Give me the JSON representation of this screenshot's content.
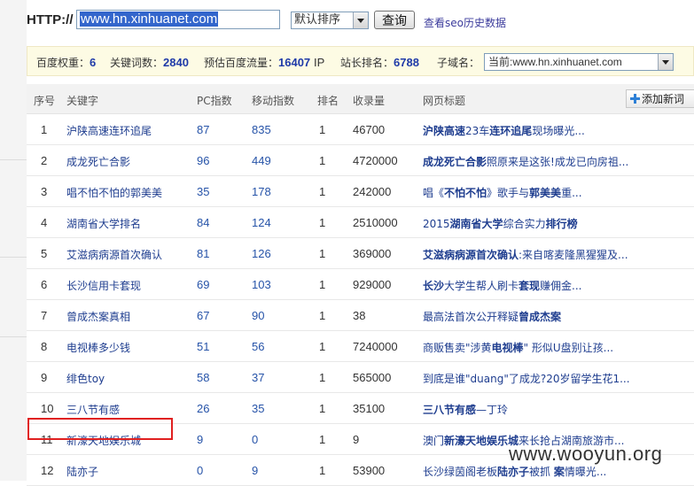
{
  "search": {
    "protocol_label": "HTTP://",
    "url_value": "www.hn.xinhuanet.com",
    "sort_selected": "默认排序",
    "query_button": "查询",
    "history_link": "查看seo历史数据"
  },
  "stats": {
    "baidu_weight_label": "百度权重：",
    "baidu_weight": "6",
    "keywords_label": "关键词数：",
    "keywords": "2840",
    "traffic_label": "预估百度流量：",
    "traffic": "16407",
    "traffic_unit": "IP",
    "rank_label": "站长排名：",
    "rank": "6788",
    "subdomain_label": "子域名：",
    "subdomain_selected": "当前:www.hn.xinhuanet.com"
  },
  "table": {
    "headers": {
      "index": "序号",
      "keyword": "关键字",
      "pc": "PC指数",
      "mobile": "移动指数",
      "rank": "排名",
      "indexed": "收录量",
      "title": "网页标题"
    },
    "add_button": "添加新词",
    "rows": [
      {
        "index": "1",
        "keyword": "沪陕高速连环追尾",
        "pc": "87",
        "mobile": "835",
        "rank": "1",
        "indexed": "46700",
        "title_html": "<b>沪陕高速</b>23车<b>连环追尾</b>现场曝光..."
      },
      {
        "index": "2",
        "keyword": "成龙死亡合影",
        "pc": "96",
        "mobile": "449",
        "rank": "1",
        "indexed": "4720000",
        "title_html": "<b>成龙死亡合影</b>照原来是这张!成龙已向房祖..."
      },
      {
        "index": "3",
        "keyword": "唱不怕不怕的郭美美",
        "pc": "35",
        "mobile": "178",
        "rank": "1",
        "indexed": "242000",
        "title_html": "唱《<b>不怕不怕</b>》歌手与<b>郭美美</b>重..."
      },
      {
        "index": "4",
        "keyword": "湖南省大学排名",
        "pc": "84",
        "mobile": "124",
        "rank": "1",
        "indexed": "2510000",
        "title_html": "2015<b>湖南省大学</b>综合实力<b>排行榜</b>"
      },
      {
        "index": "5",
        "keyword": "艾滋病病源首次确认",
        "pc": "81",
        "mobile": "126",
        "rank": "1",
        "indexed": "369000",
        "title_html": "<b>艾滋病病源首次确认</b>:来自喀麦隆黑猩猩及..."
      },
      {
        "index": "6",
        "keyword": "长沙信用卡套现",
        "pc": "69",
        "mobile": "103",
        "rank": "1",
        "indexed": "929000",
        "title_html": "<b>长沙</b>大学生帮人刷卡<b>套现</b>赚佣金..."
      },
      {
        "index": "7",
        "keyword": "曾成杰案真相",
        "pc": "67",
        "mobile": "90",
        "rank": "1",
        "indexed": "38",
        "title_html": "最高法首次公开释疑<b>曾成杰案</b>"
      },
      {
        "index": "8",
        "keyword": "电视棒多少钱",
        "pc": "51",
        "mobile": "56",
        "rank": "1",
        "indexed": "7240000",
        "title_html": "商贩售卖\"涉黄<b>电视棒</b>\" 形似U盘别让孩..."
      },
      {
        "index": "9",
        "keyword": "绯色toy",
        "pc": "58",
        "mobile": "37",
        "rank": "1",
        "indexed": "565000",
        "title_html": "到底是谁\"duang\"了成龙?20岁留学生花1..."
      },
      {
        "index": "10",
        "keyword": "三八节有感",
        "pc": "26",
        "mobile": "35",
        "rank": "1",
        "indexed": "35100",
        "title_html": "<b>三八节有感</b>—丁玲"
      },
      {
        "index": "11",
        "keyword": "新濠天地娱乐城",
        "pc": "9",
        "mobile": "0",
        "rank": "1",
        "indexed": "9",
        "title_html": "澳门<b>新濠天地娱乐城</b>来长抢占湖南旅游市..."
      },
      {
        "index": "12",
        "keyword": "陆亦子",
        "pc": "0",
        "mobile": "9",
        "rank": "1",
        "indexed": "53900",
        "title_html": "长沙绿茵阁老板<b>陆亦子</b>被抓 <b>案</b>情曝光..."
      }
    ]
  },
  "watermark": "www.wooyun.org",
  "colors": {
    "link": "#1e3d8f",
    "stat_value": "#1f3aa8",
    "highlight": "#e02020",
    "stats_bg": "#fdfbe4"
  }
}
